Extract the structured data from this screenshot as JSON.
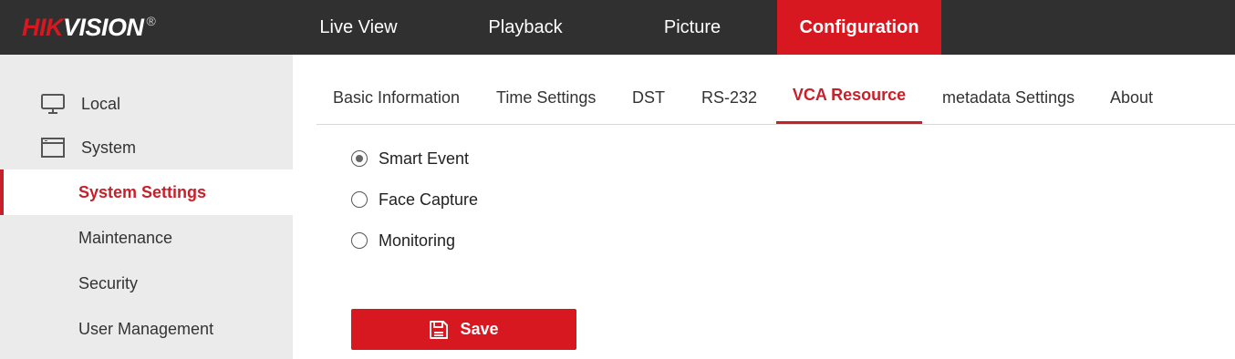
{
  "brand": {
    "name_part1": "HIK",
    "name_part2": "VISION",
    "registered": "®"
  },
  "nav": {
    "items": [
      {
        "label": "Live View"
      },
      {
        "label": "Playback"
      },
      {
        "label": "Picture"
      },
      {
        "label": "Configuration",
        "active": true
      }
    ]
  },
  "sidebar": {
    "sections": [
      {
        "label": "Local",
        "icon": "monitor-icon"
      },
      {
        "label": "System",
        "icon": "window-icon"
      }
    ],
    "subitems": [
      {
        "label": "System Settings",
        "active": true
      },
      {
        "label": "Maintenance"
      },
      {
        "label": "Security"
      },
      {
        "label": "User Management"
      }
    ]
  },
  "tabs": [
    {
      "label": "Basic Information"
    },
    {
      "label": "Time Settings"
    },
    {
      "label": "DST"
    },
    {
      "label": "RS-232"
    },
    {
      "label": "VCA Resource",
      "active": true
    },
    {
      "label": "metadata Settings"
    },
    {
      "label": "About"
    }
  ],
  "vca_options": [
    {
      "label": "Smart Event",
      "checked": true
    },
    {
      "label": "Face Capture",
      "checked": false
    },
    {
      "label": "Monitoring",
      "checked": false
    }
  ],
  "save": {
    "label": "Save",
    "icon": "save-icon"
  },
  "colors": {
    "accent": "#d71820",
    "topbar": "#303030",
    "sidebar": "#ebebeb",
    "active_text": "#c8202a"
  }
}
